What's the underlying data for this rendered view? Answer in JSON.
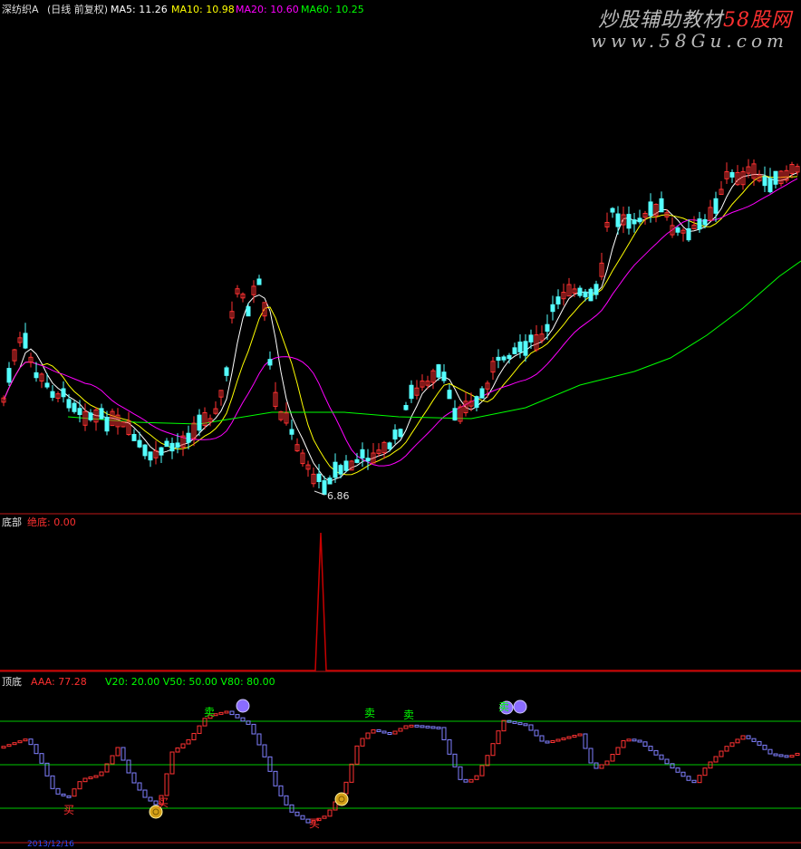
{
  "header": {
    "symbol": "深纺织A",
    "period": "(日线 前复权)",
    "ma5": "MA5: 11.26",
    "ma10": "MA10: 10.98",
    "ma20": "MA20: 10.60",
    "ma60": "MA60: 10.25"
  },
  "watermark": {
    "line1_a": "炒股辅助教材",
    "line1_b": "58股网",
    "line2": "www.58Gu.com"
  },
  "price_panel": {
    "low_label": "6.86"
  },
  "bottom_panel": {
    "name": "底部",
    "indicator": "绝底: 0.00"
  },
  "top_bottom_panel": {
    "name": "顶底",
    "aaa": "AAA: 77.28",
    "levels": "V20: 20.00  V50: 50.00  V80: 80.00",
    "sell": "卖",
    "buy": "买"
  },
  "date_axis": {
    "label": "2013/12/16"
  },
  "colors": {
    "up": "#ff3232",
    "down": "#54ffff",
    "ma5": "#ffffff",
    "ma10": "#ffff00",
    "ma20": "#ff00ff",
    "ma60": "#00ff00",
    "panel_border": "#c01818",
    "signal": "#c80000",
    "band": "#00c800",
    "oscillator_down": "#8080ff"
  },
  "chart_data": {
    "type": "candlestick",
    "low_price": 6.86,
    "oscillator_levels": [
      20,
      50,
      80
    ],
    "oscillator_last": 77.28
  }
}
